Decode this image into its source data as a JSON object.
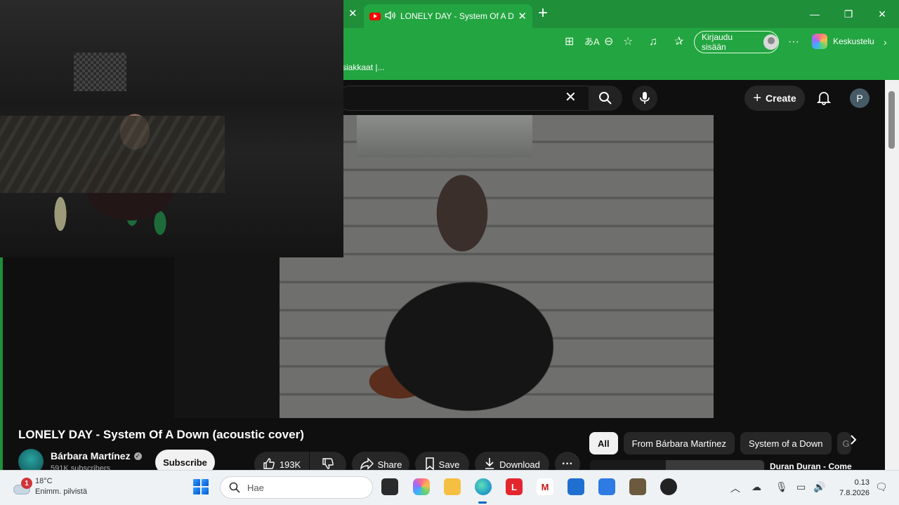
{
  "browser": {
    "tab_title": "LONELY DAY - System Of A Down",
    "signin_label": "Kirjaudu sisään",
    "copilot_label": "Keskustelu",
    "favorite_item": "siakkaat |..."
  },
  "youtube": {
    "create_label": "Create",
    "profile_initial": "P",
    "video_title": "LONELY DAY - System Of A Down (acoustic cover)",
    "channel_name": "Bárbara Martínez",
    "subscribers": "591K subscribers",
    "subscribe_label": "Subscribe",
    "likes": "193K",
    "share_label": "Share",
    "save_label": "Save",
    "download_label": "Download",
    "chips": [
      "All",
      "From Bárbara Martínez",
      "System of a Down",
      "G"
    ],
    "recommendation_title": "Duran Duran - Come"
  },
  "taskbar": {
    "weather_temp": "18°C",
    "weather_desc": "Enimm. pilvistä",
    "weather_badge": "1",
    "search_placeholder": "Hae",
    "time": "0.13",
    "date": "7.8.2026"
  },
  "colors": {
    "browser_frame": "#1f8f3a",
    "youtube_bg": "#0f0f0f",
    "taskbar_bg": "#eef2f5"
  }
}
